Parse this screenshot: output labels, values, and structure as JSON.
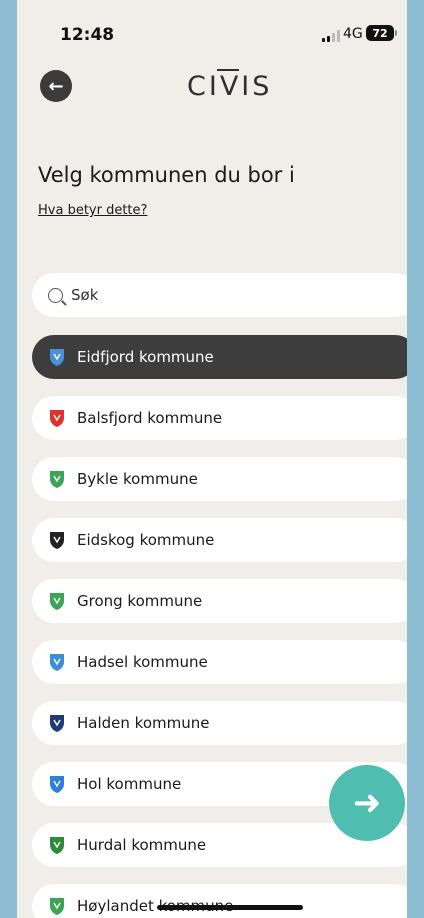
{
  "status_bar": {
    "time": "12:48",
    "network": "4G",
    "battery": "72"
  },
  "header": {
    "logo_text": "CIVIS",
    "back_icon": "arrow-left-icon"
  },
  "main": {
    "title": "Velg kommunen du bor i",
    "help_link": "Hva betyr dette?",
    "search": {
      "placeholder": "Søk"
    },
    "municipalities": [
      {
        "label": "Eidfjord kommune",
        "selected": true,
        "crest_color": "#4a90d9"
      },
      {
        "label": "Balsfjord kommune",
        "selected": false,
        "crest_color": "#e0322b"
      },
      {
        "label": "Bykle kommune",
        "selected": false,
        "crest_color": "#3aa655"
      },
      {
        "label": "Eidskog kommune",
        "selected": false,
        "crest_color": "#222222"
      },
      {
        "label": "Grong kommune",
        "selected": false,
        "crest_color": "#3aa655"
      },
      {
        "label": "Hadsel kommune",
        "selected": false,
        "crest_color": "#3d8fd4"
      },
      {
        "label": "Halden kommune",
        "selected": false,
        "crest_color": "#1e3a78"
      },
      {
        "label": "Hol kommune",
        "selected": false,
        "crest_color": "#2f7fd6"
      },
      {
        "label": "Hurdal kommune",
        "selected": false,
        "crest_color": "#2e8b3a"
      },
      {
        "label": "Høylandet kommune",
        "selected": false,
        "crest_color": "#3aa655"
      }
    ]
  },
  "fab": {
    "icon": "arrow-right-icon"
  },
  "colors": {
    "accent": "#4fbdb0",
    "selected_bg": "#3d3d3d",
    "background": "#f1eeea"
  }
}
